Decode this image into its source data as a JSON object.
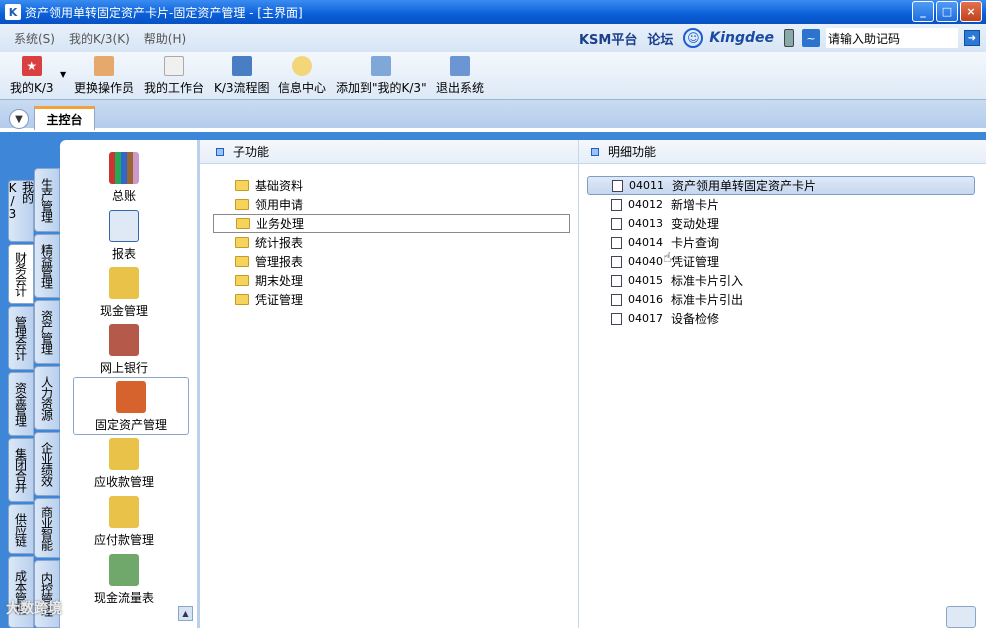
{
  "window": {
    "title": "资产领用单转固定资产卡片-固定资产管理 - [主界面]",
    "minimize_icon": "minimize-icon",
    "maximize_icon": "maximize-icon",
    "close_icon": "close-icon"
  },
  "menubar": {
    "items": [
      "系统(S)",
      "我的K/3(K)",
      "帮助(H)"
    ],
    "brand": {
      "ksm": "KSM平台",
      "forum": "论坛",
      "logo": "Kingdee"
    },
    "hint_input_value": "请输入助记码"
  },
  "toolbar": {
    "items": [
      "我的K/3",
      "更换操作员",
      "我的工作台",
      "K/3流程图",
      "信息中心",
      "添加到\"我的K/3\"",
      "退出系统"
    ]
  },
  "tabs": {
    "main": "主控台"
  },
  "vertical_tabs_outer": [
    "我的K/3",
    "财务会计",
    "管理会计",
    "资金管理",
    "集团合并",
    "供应链",
    "成本管理"
  ],
  "vertical_tabs_inner": [
    "生产管理",
    "精益管理",
    "资产管理",
    "人力资源",
    "企业绩效",
    "商业智能",
    "内控管理"
  ],
  "nav": {
    "items": [
      "总账",
      "报表",
      "现金管理",
      "网上银行",
      "固定资产管理",
      "应收款管理",
      "应付款管理",
      "现金流量表"
    ],
    "active": "固定资产管理"
  },
  "sub_functions": {
    "header": "子功能",
    "folders": [
      "基础资料",
      "领用申请",
      "业务处理",
      "统计报表",
      "管理报表",
      "期末处理",
      "凭证管理"
    ],
    "selected": "业务处理"
  },
  "detail_functions": {
    "header": "明细功能",
    "items": [
      {
        "code": "04011",
        "name": "资产领用单转固定资产卡片"
      },
      {
        "code": "04012",
        "name": "新增卡片"
      },
      {
        "code": "04013",
        "name": "变动处理"
      },
      {
        "code": "04014",
        "name": "卡片查询"
      },
      {
        "code": "04040",
        "name": "凭证管理"
      },
      {
        "code": "04015",
        "name": "标准卡片引入"
      },
      {
        "code": "04016",
        "name": "标准卡片引出"
      },
      {
        "code": "04017",
        "name": "设备检修"
      }
    ],
    "selected_code": "04011"
  },
  "watermark": "大数跨境",
  "colors": {
    "title_bar": "#0a5fd8",
    "background": "#3d86d8",
    "tab_accent": "#f2a23a"
  }
}
